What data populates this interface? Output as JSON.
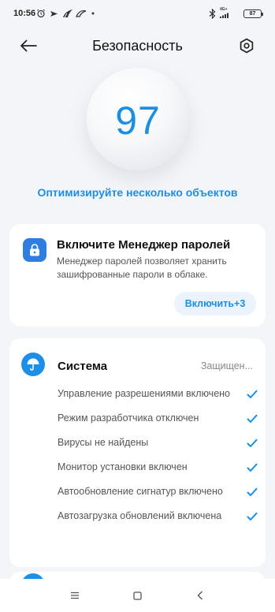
{
  "status_bar": {
    "time": "10:56",
    "battery": "87",
    "network": "4G+"
  },
  "header": {
    "title": "Безопасность",
    "back_icon": "arrow-left-icon",
    "settings_icon": "gear-icon"
  },
  "score": {
    "value": "97",
    "action": "Оптимизируйте несколько объектов"
  },
  "password_card": {
    "icon": "lock-icon",
    "title": "Включите Менеджер паролей",
    "description": "Менеджер паролей позволяет хранить зашифрованные пароли в облаке.",
    "button": "Включить+3"
  },
  "system_card": {
    "icon": "umbrella-icon",
    "title": "Система",
    "status": "Защищен...",
    "items": [
      "Управление разрешениями включено",
      "Режим разработчика отключен",
      "Вирусы не найдены",
      "Монитор установки включен",
      "Автообновление сигнатур включено",
      "Автозагрузка обновлений включена"
    ]
  },
  "colors": {
    "accent": "#1b8fe2",
    "background": "#f3f5f8",
    "card": "#ffffff"
  }
}
